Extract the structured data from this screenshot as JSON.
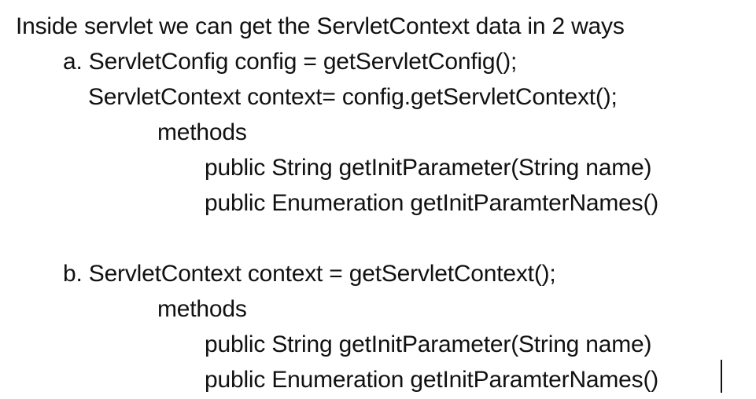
{
  "slide": {
    "heading": "Inside servlet we can get the ServletContext data in 2 ways",
    "option_a": {
      "line1": "a. ServletConfig config = getServletConfig();",
      "line2": "ServletContext context= config.getServletContext();",
      "methods_label": "methods",
      "methods": [
        "public String getInitParameter(String name)",
        "public Enumeration getInitParamterNames()"
      ]
    },
    "option_b": {
      "line1": "b. ServletContext context = getServletContext();",
      "methods_label": "methods",
      "methods": [
        "public String getInitParameter(String name)",
        "public Enumeration getInitParamterNames()"
      ]
    }
  }
}
